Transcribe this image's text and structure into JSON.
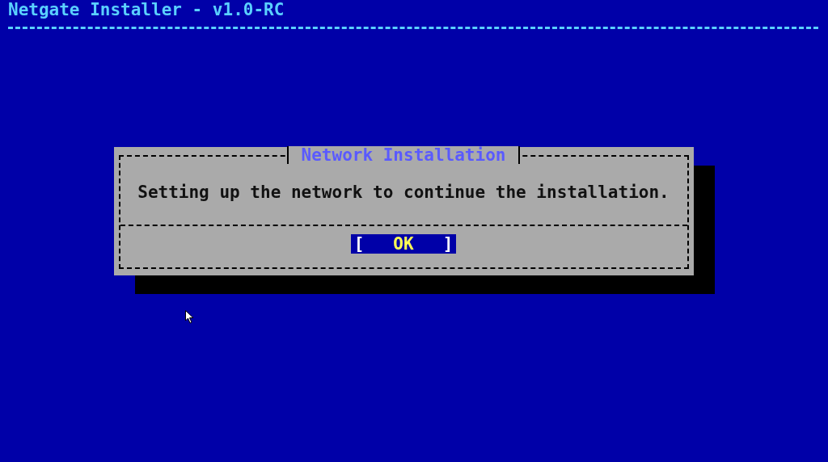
{
  "window": {
    "title": "Netgate Installer - v1.0-RC"
  },
  "dialog": {
    "title": "Network Installation",
    "message": "Setting up the network to continue the installation.",
    "buttons": [
      {
        "label": "OK",
        "bracket_open": "[",
        "bracket_close": "]",
        "selected": true
      }
    ]
  }
}
